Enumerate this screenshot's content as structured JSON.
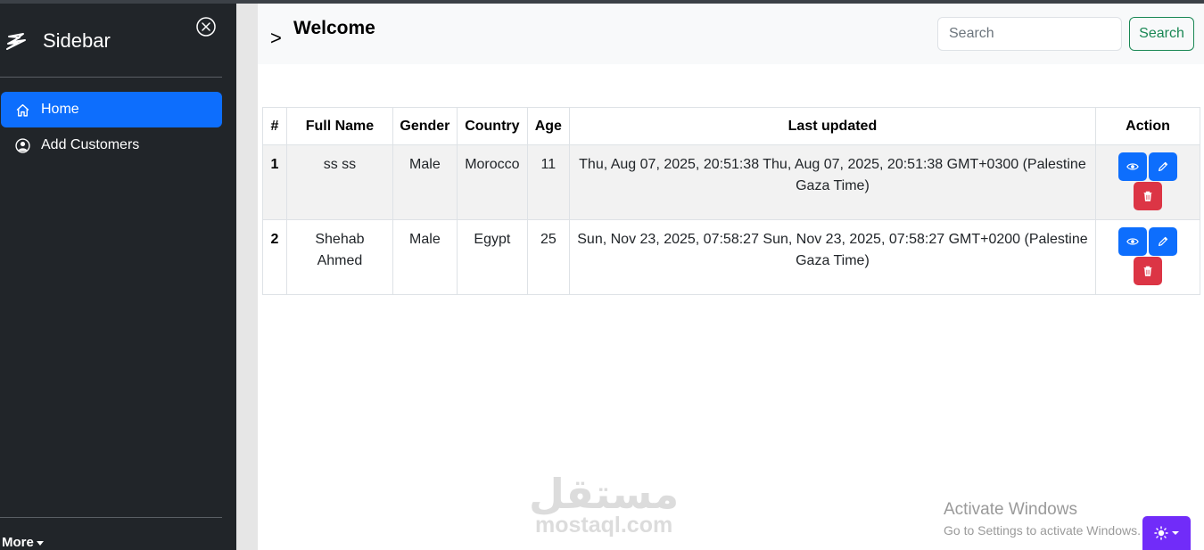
{
  "sidebar": {
    "title": "Sidebar",
    "brand_icon": "lightning-bolt-icon",
    "close_icon": "close-circle-icon",
    "items": [
      {
        "label": "Home",
        "icon": "home-icon",
        "active": true
      },
      {
        "label": "Add Customers",
        "icon": "user-circle-icon",
        "active": false
      }
    ],
    "more_label": "More"
  },
  "header": {
    "chevron": ">",
    "title": "Welcome",
    "search_placeholder": "Search",
    "search_button": "Search"
  },
  "table": {
    "columns": [
      "#",
      "Full Name",
      "Gender",
      "Country",
      "Age",
      "Last updated",
      "Action"
    ],
    "rows": [
      {
        "index": "1",
        "full_name": "ss ss",
        "gender": "Male",
        "country": "Morocco",
        "age": "11",
        "last_updated": "Thu, Aug 07, 2025, 20:51:38 Thu, Aug 07, 2025, 20:51:38 GMT+0300 (Palestine Gaza Time)"
      },
      {
        "index": "2",
        "full_name": "Shehab Ahmed",
        "gender": "Male",
        "country": "Egypt",
        "age": "25",
        "last_updated": "Sun, Nov 23, 2025, 07:58:27 Sun, Nov 23, 2025, 07:58:27 GMT+0200 (Palestine Gaza Time)"
      }
    ],
    "action_icons": [
      "eye-icon",
      "pencil-icon",
      "trash-icon"
    ]
  },
  "watermark": {
    "arabic": "مستقل",
    "site": "mostaql.com"
  },
  "windows_notice": {
    "title": "Activate Windows",
    "subtitle": "Go to Settings to activate Windows."
  },
  "theme_toggle": {
    "icon": "sun-icon"
  },
  "colors": {
    "sidebar_bg": "#212529",
    "primary": "#0d6efd",
    "danger": "#dc3545",
    "success": "#198754",
    "theme_toggle": "#712cf9"
  }
}
